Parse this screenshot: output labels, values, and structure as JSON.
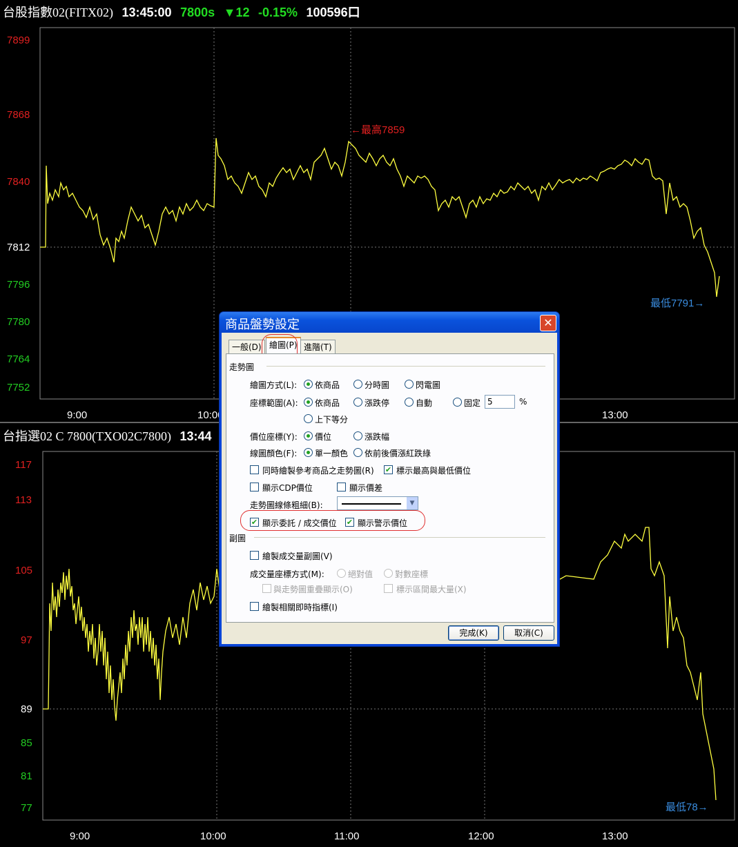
{
  "top_chart": {
    "header": {
      "name": "台股指數02(FITX02)",
      "time": "13:45:00",
      "price": "7800s",
      "change": "▼12",
      "change_pct": "-0.15%",
      "volume": "100596口"
    },
    "y_labels_red": [
      "7899",
      "7868"
    ],
    "y_labels_white": [
      "7840",
      "7812"
    ],
    "y_labels_green": [
      "7796",
      "7780",
      "7764",
      "7752"
    ],
    "x_labels": [
      "9:00",
      "10:00",
      "13:00"
    ],
    "annotation_high": "←最高7859",
    "annotation_low": "最低7791→"
  },
  "bottom_chart": {
    "header": {
      "name": "台指選02 C 7800(TXO02C7800)",
      "time": "13:44"
    },
    "y_labels_red": [
      "117",
      "113",
      "105",
      "97"
    ],
    "y_labels_white": [
      "89"
    ],
    "y_labels_green": [
      "85",
      "81",
      "77"
    ],
    "x_labels": [
      "9:00",
      "10:00",
      "11:00",
      "12:00",
      "13:00"
    ],
    "annotation_low": "最低78→"
  },
  "dialog": {
    "title": "商品盤勢設定",
    "tabs": [
      "一般(D)",
      "繪圖(P)",
      "進階(T)"
    ],
    "section_trend": "走勢圖",
    "row_draw_mode": {
      "label": "繪圖方式(L):",
      "options": [
        "依商品",
        "分時圖",
        "閃電圖"
      ]
    },
    "row_coord_range": {
      "label": "座標範圍(A):",
      "options": [
        "依商品",
        "漲跌停",
        "自動",
        "固定",
        "上下等分"
      ],
      "fixed_value": "5",
      "unit": "%"
    },
    "row_price_coord": {
      "label": "價位座標(Y):",
      "options": [
        "價位",
        "漲跌幅"
      ]
    },
    "row_line_color": {
      "label": "線圖顏色(F):",
      "options": [
        "單一顏色",
        "依前後價漲紅跌綠"
      ]
    },
    "chk_ref_chart": "同時繪製參考商品之走勢圖(R)",
    "chk_high_low": "標示最高與最低價位",
    "chk_cdp": "顯示CDP價位",
    "chk_spread": "顯示價差",
    "line_width_label": "走勢圖線條粗細(B):",
    "chk_order_price": "顯示委託 / 成交價位",
    "chk_alert_price": "顯示警示價位",
    "section_sub": "副圖",
    "chk_volume_sub": "繪製成交量副圖(V)",
    "vol_coord_label": "成交量座標方式(M):",
    "vol_coord_options": [
      "絕對值",
      "對數座標"
    ],
    "chk_overlay": "與走勢圖重疊顯示(O)",
    "chk_max_vol": "標示區間最大量(X)",
    "chk_realtime": "繪製相關即時指標(I)",
    "btn_ok": "完成(K)",
    "btn_cancel": "取消(C)",
    "close_glyph": "✕"
  }
}
